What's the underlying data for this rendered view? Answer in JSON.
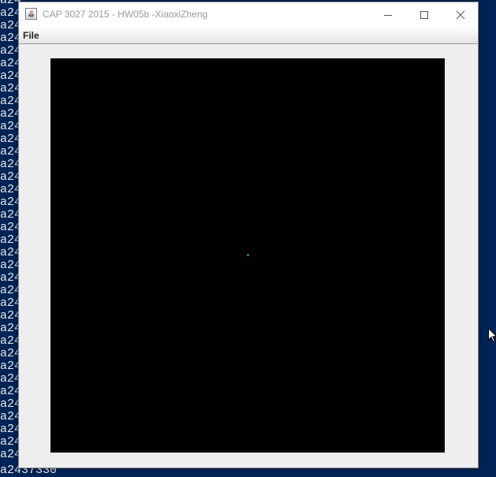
{
  "console": {
    "lines": [
      "a24",
      "a24",
      "a24",
      "a24",
      "a24",
      "a24",
      "a24",
      "a24",
      "a24",
      "a24",
      "a24",
      "a24",
      "a24",
      "a24",
      "a24",
      "a24",
      "a24",
      "a24",
      "a24",
      "a24",
      "a24",
      "a24",
      "a24",
      "a24",
      "a24",
      "a24",
      "a24",
      "a24",
      "a24",
      "a24",
      "a24",
      "a24",
      "a24",
      "a24",
      "a24",
      "a24",
      "a24"
    ],
    "last_line": "a2437330"
  },
  "window": {
    "title": "CAP 3027 2015 - HW05b -XiaoxiZheng",
    "menu": {
      "file_label": "File"
    }
  },
  "canvas": {
    "background": "#000000",
    "particle_color": "#2f6f86"
  },
  "icons": {
    "app": "java-app-icon",
    "minimize": "minimize-icon",
    "maximize": "maximize-icon",
    "close": "close-icon",
    "cursor": "mouse-pointer-icon"
  }
}
